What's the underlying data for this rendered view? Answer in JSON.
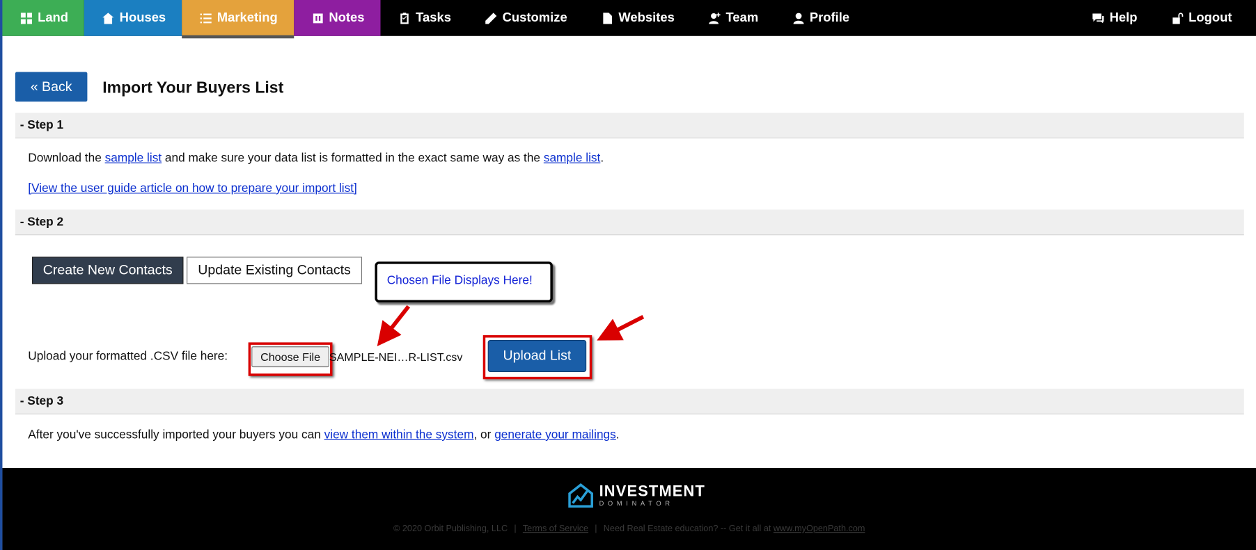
{
  "nav": {
    "left": [
      {
        "label": "Land",
        "color": "#3dae55",
        "icon": "grid-icon"
      },
      {
        "label": "Houses",
        "color": "#1b7fc1",
        "icon": "home-icon"
      },
      {
        "label": "Marketing",
        "color": "#e4a23c",
        "icon": "list-icon"
      },
      {
        "label": "Notes",
        "color": "#8e1ea0",
        "icon": "notes-icon"
      },
      {
        "label": "Tasks",
        "color": "#000000",
        "icon": "clipboard-icon"
      },
      {
        "label": "Customize",
        "color": "#000000",
        "icon": "pencil-icon"
      },
      {
        "label": "Websites",
        "color": "#000000",
        "icon": "document-icon"
      },
      {
        "label": "Team",
        "color": "#000000",
        "icon": "user-add-icon"
      },
      {
        "label": "Profile",
        "color": "#000000",
        "icon": "user-icon"
      }
    ],
    "right": [
      {
        "label": "Help",
        "icon": "chat-icon"
      },
      {
        "label": "Logout",
        "icon": "unlock-icon"
      }
    ],
    "active": "Marketing"
  },
  "back_button": "« Back",
  "page_title": "Import Your Buyers List",
  "step1": {
    "heading": "- Step 1",
    "line_prefix": "Download the ",
    "link1": "sample list",
    "line_middle": " and make sure your data list is formatted in the exact same way as the ",
    "link2": "sample list",
    "line_suffix": ".",
    "guide_link": "[View the user guide article on how to prepare your import list]"
  },
  "step2": {
    "heading": "- Step 2",
    "create_button": "Create New Contacts",
    "update_button": "Update Existing Contacts",
    "callout": "Chosen File Displays Here!",
    "upload_label": "Upload your formatted .CSV file here:",
    "choose_file": "Choose File",
    "file_name": "SAMPLE-NEI…R-LIST.csv",
    "upload_button": "Upload List"
  },
  "step3": {
    "heading": "- Step 3",
    "prefix": "After you've successfully imported your buyers you can ",
    "link1": "view them within the system",
    "middle": ", or ",
    "link2": "generate your mailings",
    "suffix": "."
  },
  "footer": {
    "logo_main": "INVESTMENT",
    "logo_sub": "DOMINATOR",
    "copyright": "© 2020 Orbit Publishing, LLC",
    "terms": "Terms of Service",
    "education": "Need Real Estate education? -- Get it all at ",
    "education_link": "www.myOpenPath.com"
  },
  "colors": {
    "accent_blue": "#1a5ea8",
    "annotation_red": "#d90000"
  }
}
